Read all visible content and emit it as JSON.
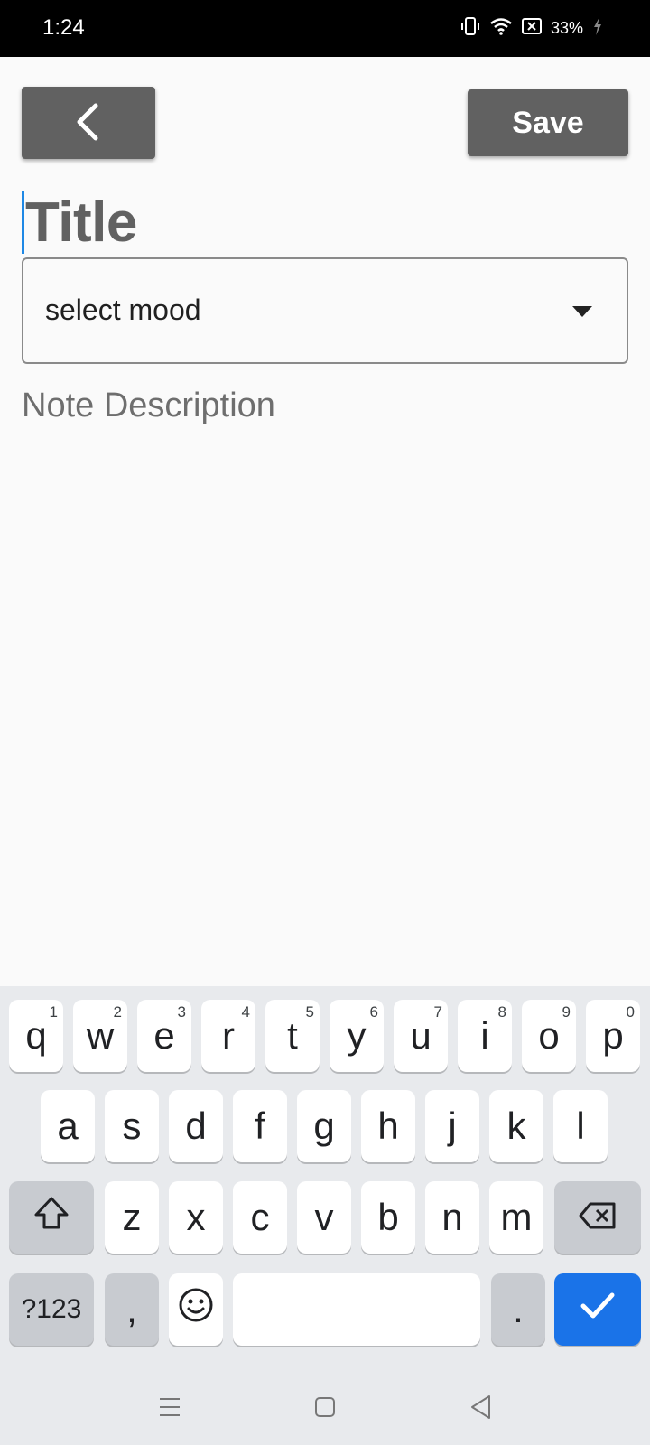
{
  "status_bar": {
    "time": "1:24",
    "battery": "33%",
    "icons": [
      "vibrate-icon",
      "wifi-icon",
      "no-sim-icon",
      "battery-charging-icon"
    ]
  },
  "appbar": {
    "back_icon": "chevron-left-icon",
    "save_label": "Save"
  },
  "form": {
    "title_placeholder": "Title",
    "mood_value": "select mood",
    "description_placeholder": "Note Description"
  },
  "keyboard": {
    "row1": [
      {
        "char": "q",
        "hint": "1"
      },
      {
        "char": "w",
        "hint": "2"
      },
      {
        "char": "e",
        "hint": "3"
      },
      {
        "char": "r",
        "hint": "4"
      },
      {
        "char": "t",
        "hint": "5"
      },
      {
        "char": "y",
        "hint": "6"
      },
      {
        "char": "u",
        "hint": "7"
      },
      {
        "char": "i",
        "hint": "8"
      },
      {
        "char": "o",
        "hint": "9"
      },
      {
        "char": "p",
        "hint": "0"
      }
    ],
    "row2": [
      "a",
      "s",
      "d",
      "f",
      "g",
      "h",
      "j",
      "k",
      "l"
    ],
    "row3": [
      "z",
      "x",
      "c",
      "v",
      "b",
      "n",
      "m"
    ],
    "symbols_label": "?123",
    "comma": ",",
    "period": "."
  },
  "colors": {
    "button_bg": "#616161",
    "caret": "#1e88e5",
    "enter_key": "#1a73e8"
  }
}
